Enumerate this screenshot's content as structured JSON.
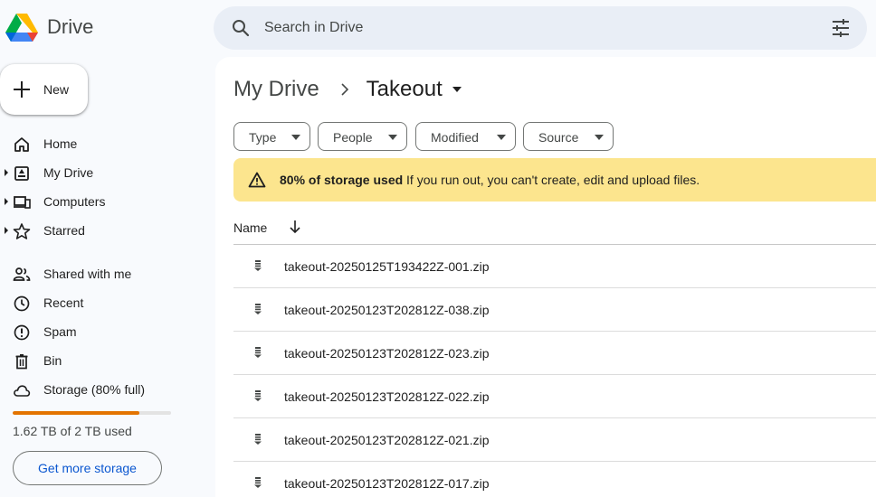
{
  "app": {
    "name": "Drive"
  },
  "search": {
    "placeholder": "Search in Drive"
  },
  "new_button": {
    "label": "New"
  },
  "sidebar": {
    "items": [
      {
        "label": "Home"
      },
      {
        "label": "My Drive"
      },
      {
        "label": "Computers"
      },
      {
        "label": "Starred"
      },
      {
        "label": "Shared with me"
      },
      {
        "label": "Recent"
      },
      {
        "label": "Spam"
      },
      {
        "label": "Bin"
      },
      {
        "label": "Storage (80% full)"
      }
    ],
    "storage": {
      "used_fraction": 0.8,
      "text": "1.62 TB of 2 TB used",
      "button_label": "Get more storage",
      "bar_color": "#e37400"
    }
  },
  "breadcrumb": {
    "root": "My Drive",
    "current": "Takeout"
  },
  "filters": [
    {
      "label": "Type"
    },
    {
      "label": "People"
    },
    {
      "label": "Modified"
    },
    {
      "label": "Source"
    }
  ],
  "banner": {
    "bold": "80% of storage used",
    "message": "If you run out, you can't create, edit and upload files.",
    "color": "#fce58e"
  },
  "table": {
    "column_name": "Name",
    "files": [
      "takeout-20250125T193422Z-001.zip",
      "takeout-20250123T202812Z-038.zip",
      "takeout-20250123T202812Z-023.zip",
      "takeout-20250123T202812Z-022.zip",
      "takeout-20250123T202812Z-021.zip",
      "takeout-20250123T202812Z-017.zip"
    ]
  },
  "icons": {
    "logo": "google-drive-logo",
    "search": "search-icon",
    "filter": "tune-icon",
    "new": "plus-icon",
    "home": "home-icon",
    "my_drive": "my-drive-icon",
    "computers": "computers-icon",
    "starred": "star-icon",
    "shared": "people-icon",
    "recent": "clock-icon",
    "spam": "spam-icon",
    "bin": "trash-icon",
    "storage": "cloud-icon",
    "warning": "warning-icon",
    "sort": "arrow-down-icon",
    "file": "zip-file-icon"
  }
}
